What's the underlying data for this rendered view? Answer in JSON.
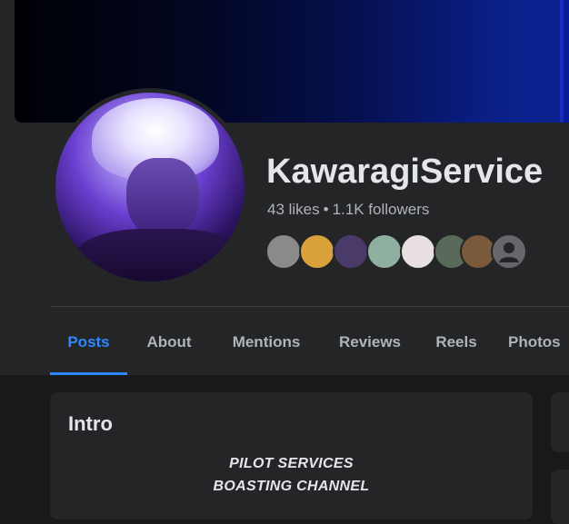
{
  "page": {
    "name": "KawaragiService",
    "likes": "43 likes",
    "separator": "•",
    "followers": "1.1K followers"
  },
  "friends": [
    {
      "icon": "friend-avatar-1",
      "color": "#8a8a8a"
    },
    {
      "icon": "friend-avatar-2",
      "color": "#d9a23a"
    },
    {
      "icon": "friend-avatar-3",
      "color": "#4a3a6a"
    },
    {
      "icon": "friend-avatar-4",
      "color": "#8fb0a0"
    },
    {
      "icon": "friend-avatar-5",
      "color": "#e8e0e0"
    },
    {
      "icon": "friend-avatar-6",
      "color": "#5a6a5a"
    },
    {
      "icon": "friend-avatar-7",
      "color": "#7a5a3a"
    },
    {
      "icon": "friend-avatar-default",
      "color": "#65676b"
    }
  ],
  "tabs": [
    {
      "label": "Posts",
      "active": true
    },
    {
      "label": "About"
    },
    {
      "label": "Mentions"
    },
    {
      "label": "Reviews"
    },
    {
      "label": "Reels"
    },
    {
      "label": "Photos"
    }
  ],
  "intro": {
    "title": "Intro",
    "lines": [
      "PILOT SERVICES",
      "BOASTING CHANNEL"
    ]
  },
  "colors": {
    "accent": "#2d88ff",
    "background": "#18191a",
    "surface": "#242526"
  }
}
